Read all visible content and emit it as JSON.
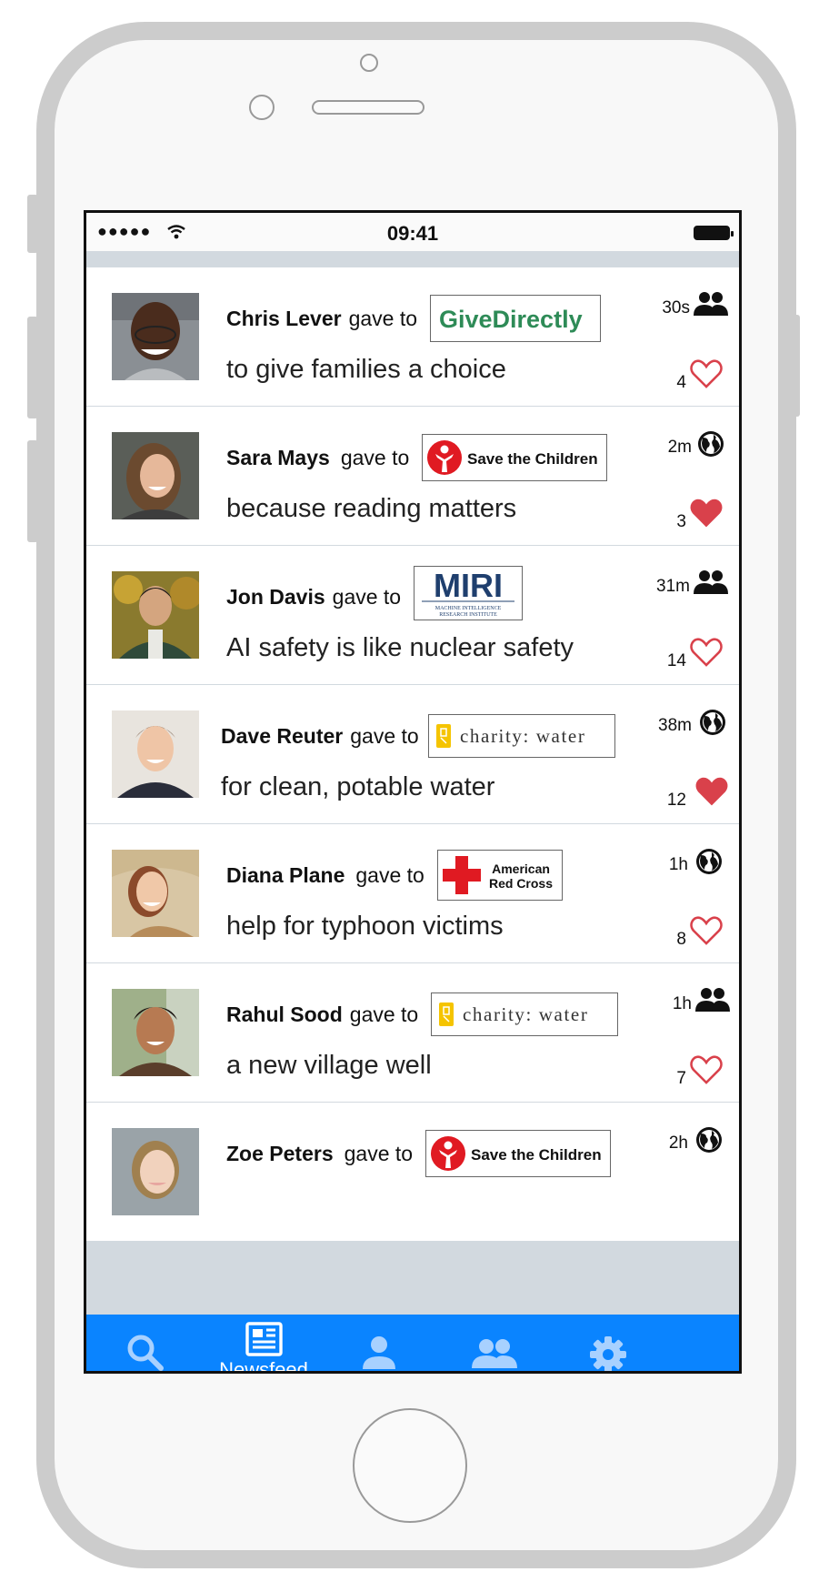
{
  "status_bar": {
    "time": "09:41",
    "signal_dots": "●●●●●"
  },
  "feed": [
    {
      "name": "Chris Lever",
      "gave_to": "gave to",
      "charity": "GiveDirectly",
      "message": "to give families a choice",
      "time": "30s",
      "audience": "friends",
      "likes": "4",
      "liked": false
    },
    {
      "name": "Sara Mays",
      "gave_to": "gave to",
      "charity": "Save the Children",
      "message": "because reading matters",
      "time": "2m",
      "audience": "public",
      "likes": "3",
      "liked": true
    },
    {
      "name": "Jon Davis",
      "gave_to": "gave to",
      "charity": "MIRI",
      "charity_sub": "MACHINE INTELLIGENCE RESEARCH INSTITUTE",
      "message": "AI safety is like nuclear safety",
      "time": "31m",
      "audience": "friends",
      "likes": "14",
      "liked": false
    },
    {
      "name": "Dave Reuter",
      "gave_to": "gave to",
      "charity": "charity: water",
      "message": "for clean, potable water",
      "time": "38m",
      "audience": "public",
      "likes": "12",
      "liked": true
    },
    {
      "name": "Diana Plane",
      "gave_to": "gave to",
      "charity": "American Red Cross",
      "charity_line1": "American",
      "charity_line2": "Red Cross",
      "message": "help for typhoon victims",
      "time": "1h",
      "audience": "public",
      "likes": "8",
      "liked": false
    },
    {
      "name": "Rahul Sood",
      "gave_to": "gave to",
      "charity": "charity: water",
      "message": "a new village well",
      "time": "1h",
      "audience": "friends",
      "likes": "7",
      "liked": false
    },
    {
      "name": "Zoe Peters",
      "gave_to": "gave to",
      "charity": "Save the Children",
      "time": "2h",
      "audience": "public"
    }
  ],
  "tabbar": {
    "active_label": "Newsfeed",
    "tabs": [
      "search-icon",
      "newsfeed-icon",
      "profile-icon",
      "friends-icon",
      "settings-icon"
    ]
  },
  "colors": {
    "tab_bar": "#0a84ff",
    "heart": "#d9414b",
    "givedirectly_green": "#2e8b57",
    "miri_blue": "#1f3f6e",
    "red_cross": "#e01a22",
    "charity_water_yellow": "#f5c400"
  }
}
